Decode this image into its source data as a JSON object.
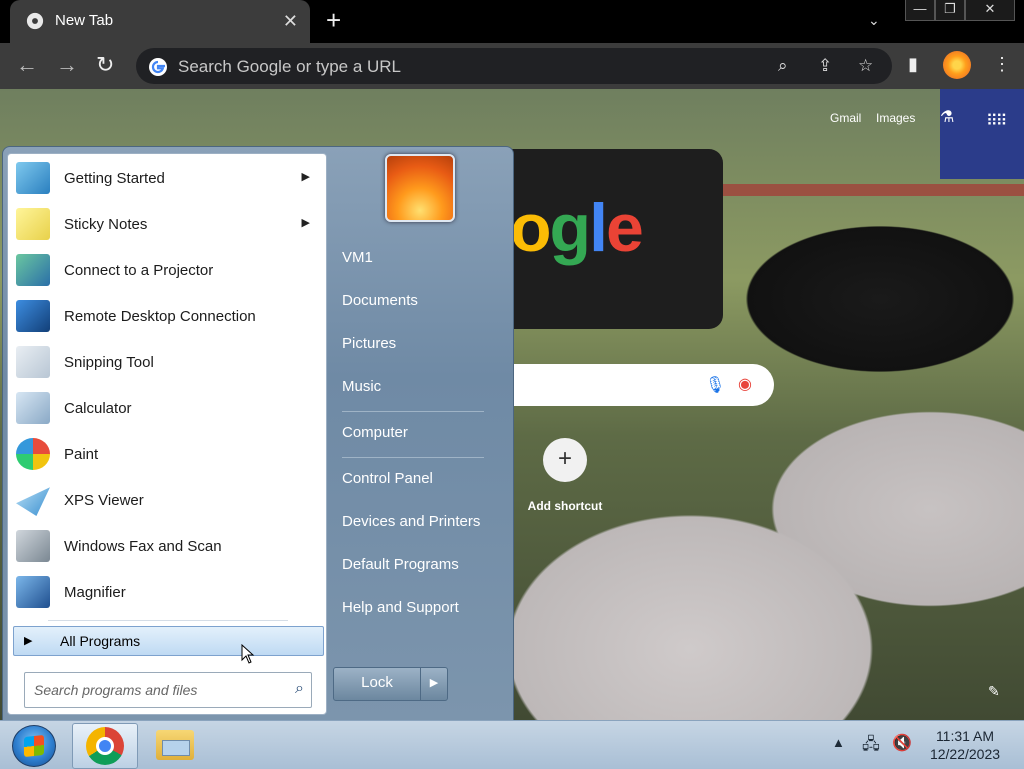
{
  "browser": {
    "tab_title": "New Tab",
    "tab_close": "✕",
    "new_tab": "+",
    "tab_list": "⌄",
    "win_min": "—",
    "win_max": "❐",
    "win_close": "✕",
    "omnibox_placeholder": "Search Google or type a URL",
    "back": "←",
    "forward": "→",
    "reload": "↻",
    "kebab": "⋮"
  },
  "ntp": {
    "gmail": "Gmail",
    "images": "Images",
    "doodle_text": "ogle",
    "add_shortcut": "Add shortcut",
    "add_plus": "+"
  },
  "start_menu": {
    "programs": [
      {
        "label": "Getting Started",
        "has_submenu": true
      },
      {
        "label": "Sticky Notes",
        "has_submenu": true
      },
      {
        "label": "Connect to a Projector",
        "has_submenu": false
      },
      {
        "label": "Remote Desktop Connection",
        "has_submenu": false
      },
      {
        "label": "Snipping Tool",
        "has_submenu": false
      },
      {
        "label": "Calculator",
        "has_submenu": false
      },
      {
        "label": "Paint",
        "has_submenu": false
      },
      {
        "label": "XPS Viewer",
        "has_submenu": false
      },
      {
        "label": "Windows Fax and Scan",
        "has_submenu": false
      },
      {
        "label": "Magnifier",
        "has_submenu": false
      }
    ],
    "all_programs": "All Programs",
    "search_placeholder": "Search programs and files",
    "right_items": [
      "VM1",
      "Documents",
      "Pictures",
      "Music",
      "Computer",
      "Control Panel",
      "Devices and Printers",
      "Default Programs",
      "Help and Support"
    ],
    "lock": "Lock"
  },
  "taskbar": {
    "time": "11:31 AM",
    "date": "12/22/2023",
    "tray_arrow": "▲"
  },
  "colors": {
    "chrome_dark": "#3c3c3c",
    "start_blue": "#6f8aa5",
    "taskbar": "#b4c8dc"
  }
}
